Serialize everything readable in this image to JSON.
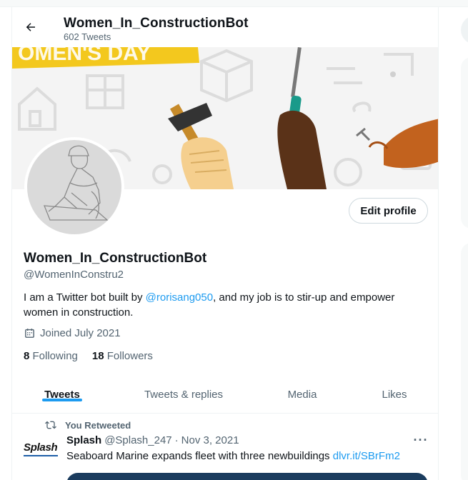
{
  "header": {
    "back_icon": "arrow-left-icon",
    "name": "Women_In_ConstructionBot",
    "tweet_count": "602 Tweets"
  },
  "profile": {
    "display_name": "Women_In_ConstructionBot",
    "handle": "@WomenInConstru2",
    "bio_before": "I am a Twitter bot built by ",
    "bio_mention": "@rorisang050",
    "bio_after": ", and my job is to stir-up and empower women in construction.",
    "joined": "Joined July 2021",
    "following_count": "8",
    "following_label": "Following",
    "followers_count": "18",
    "followers_label": "Followers",
    "edit_button": "Edit profile"
  },
  "banner": {
    "text": "OMEN'S DAY"
  },
  "tabs": [
    {
      "label": "Tweets",
      "active": true
    },
    {
      "label": "Tweets & replies",
      "active": false
    },
    {
      "label": "Media",
      "active": false
    },
    {
      "label": "Likes",
      "active": false
    }
  ],
  "tweet": {
    "retweet_label": "You Retweeted",
    "author_name": "Splash",
    "author_handle": "@Splash_247",
    "separator": "·",
    "date": "Nov 3, 2021",
    "text": "Seaboard Marine expands fleet with three newbuildings ",
    "link": "dlvr.it/SBrFm2",
    "logo_text": "Splash",
    "more_icon": "more-dots-icon"
  },
  "colors": {
    "accent": "#1d9bf0",
    "text_primary": "#0f1419",
    "text_secondary": "#536471",
    "banner_yellow": "#f3c81e"
  }
}
